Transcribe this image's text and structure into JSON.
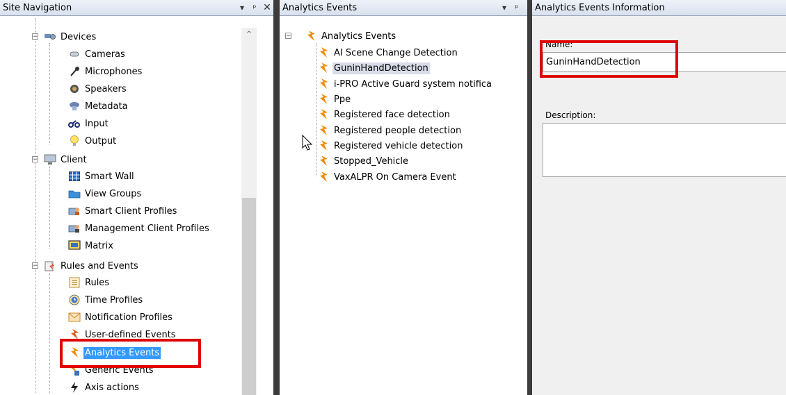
{
  "site_nav": {
    "title": "Site Navigation",
    "pin": "▾",
    "dock": "ᵠ",
    "close": "✕",
    "items": [
      {
        "label": "Devices"
      },
      {
        "label": "Cameras"
      },
      {
        "label": "Microphones"
      },
      {
        "label": "Speakers"
      },
      {
        "label": "Metadata"
      },
      {
        "label": "Input"
      },
      {
        "label": "Output"
      },
      {
        "label": "Client"
      },
      {
        "label": "Smart Wall"
      },
      {
        "label": "View Groups"
      },
      {
        "label": "Smart Client Profiles"
      },
      {
        "label": "Management Client Profiles"
      },
      {
        "label": "Matrix"
      },
      {
        "label": "Rules and Events"
      },
      {
        "label": "Rules"
      },
      {
        "label": "Time Profiles"
      },
      {
        "label": "Notification Profiles"
      },
      {
        "label": "User-defined Events"
      },
      {
        "label": "Analytics Events"
      },
      {
        "label": "Generic Events"
      },
      {
        "label": "Axis actions"
      }
    ]
  },
  "analytics_pane": {
    "title": "Analytics Events",
    "pin": "▾",
    "dock": "ᵠ",
    "root": "Analytics Events",
    "items": [
      {
        "label": "AI Scene Change Detection"
      },
      {
        "label": "GuninHandDetection"
      },
      {
        "label": "i-PRO Active Guard system notifica"
      },
      {
        "label": "Ppe"
      },
      {
        "label": "Registered face detection"
      },
      {
        "label": "Registered people detection"
      },
      {
        "label": "Registered vehicle detection"
      },
      {
        "label": "Stopped_Vehicle"
      },
      {
        "label": "VaxALPR On Camera Event"
      }
    ]
  },
  "info_pane": {
    "title": "Analytics Events Information",
    "name_label": "Name:",
    "name_value": "GuninHandDetection",
    "description_label": "Description:",
    "description_value": ""
  },
  "colors": {
    "highlight": "#e00000",
    "selection": "#3399ff",
    "event_icon": "#f08a00"
  }
}
